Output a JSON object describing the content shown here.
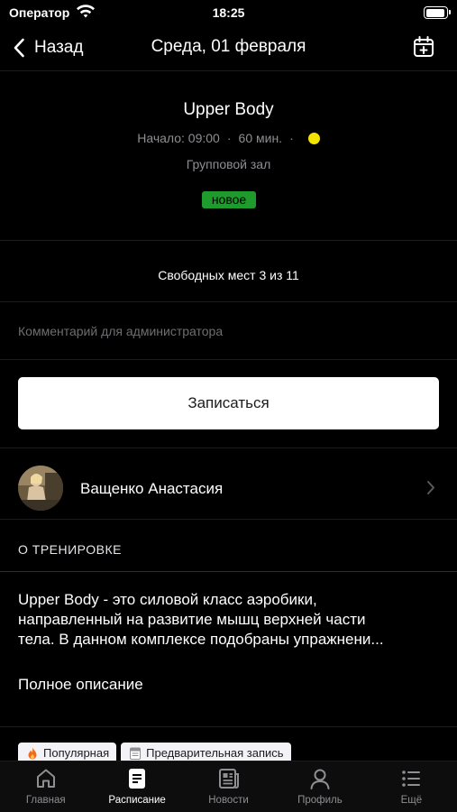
{
  "status_bar": {
    "carrier": "Оператор",
    "time": "18:25"
  },
  "nav": {
    "back_label": "Назад",
    "title": "Среда, 01 февраля"
  },
  "class": {
    "title": "Upper Body",
    "start": "Начало: 09:00",
    "duration": "60 мин.",
    "separator": "·",
    "intensity_color": "#f2e300",
    "room": "Групповой зал",
    "badge": "новое"
  },
  "free_places": "Свободных мест 3 из 11",
  "comment": {
    "placeholder": "Комментарий для администратора",
    "value": ""
  },
  "signup_button": "Записаться",
  "trainer": {
    "name": "Ващенко Анастасия"
  },
  "about": {
    "section_title": "О ТРЕНИРОВКЕ",
    "lines": [
      "Upper Body - это силовой класс аэробики,",
      "направленный на развитие мышц верхней части",
      "тела. В данном комплексе подобраны упражнени..."
    ],
    "full_link": "Полное описание"
  },
  "tags": [
    {
      "label": "Популярная",
      "icon": "flame-icon"
    },
    {
      "label": "Предварительная запись",
      "icon": "calendar-note-icon"
    }
  ],
  "tab_bar": [
    {
      "label": "Главная",
      "icon": "home-icon",
      "active": false
    },
    {
      "label": "Расписание",
      "icon": "schedule-icon",
      "active": true
    },
    {
      "label": "Новости",
      "icon": "news-icon",
      "active": false
    },
    {
      "label": "Профиль",
      "icon": "profile-icon",
      "active": false
    },
    {
      "label": "Ещё",
      "icon": "more-icon",
      "active": false
    }
  ],
  "colors": {
    "background": "#000000",
    "badge_green": "#1f9b2e",
    "intensity_yellow": "#f2e300"
  }
}
